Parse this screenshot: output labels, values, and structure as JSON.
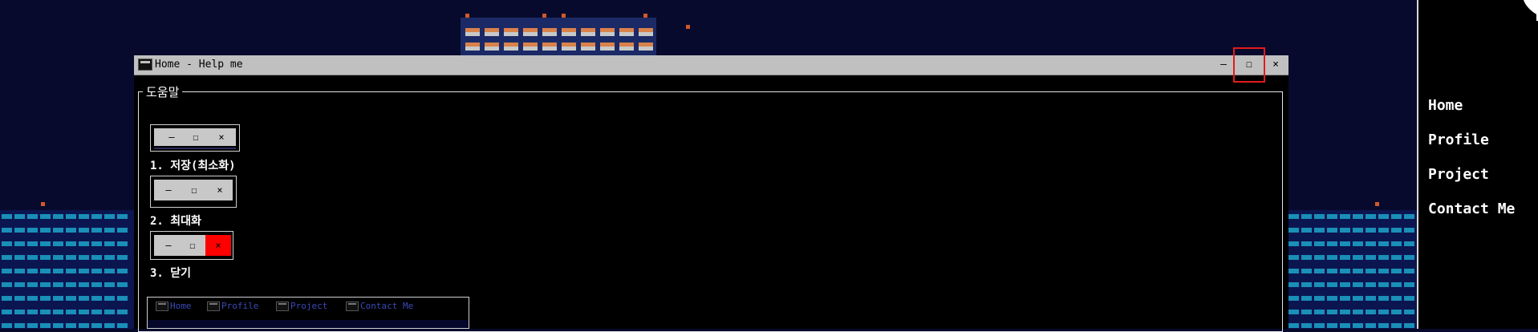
{
  "window": {
    "title": "Home - Help me",
    "minimize_glyph": "–",
    "maximize_glyph": "☐",
    "close_glyph": "×",
    "highlighted_control": "maximize"
  },
  "help": {
    "legend": "도움말",
    "steps": [
      {
        "label": "1. 저장(최소화)",
        "highlight": "minimize"
      },
      {
        "label": "2. 최대화",
        "highlight": "maximize"
      },
      {
        "label": "3. 닫기",
        "highlight": "close"
      }
    ],
    "demo_buttons": {
      "minimize": "–",
      "maximize": "☐",
      "close": "×"
    }
  },
  "mini_taskbar": {
    "items": [
      "Home",
      "Profile",
      "Project",
      "Contact Me"
    ]
  },
  "sidebar": {
    "items": [
      "Home",
      "Profile",
      "Project",
      "Contact Me"
    ]
  },
  "colors": {
    "sky": "#070a2c",
    "highlight_border": "#e21b1b",
    "close_red": "#ff0000",
    "taskbar_link": "#3a4ab8"
  }
}
